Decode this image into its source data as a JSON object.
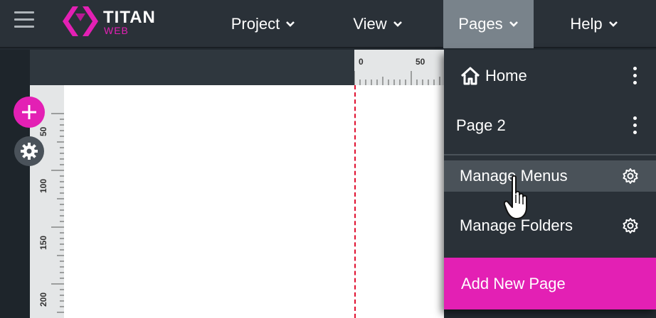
{
  "app": {
    "logo_title": "TITAN",
    "logo_sub": "WEB",
    "brand_color": "#e320b4"
  },
  "nav": {
    "project": "Project",
    "view": "View",
    "pages": "Pages",
    "help": "Help"
  },
  "ruler": {
    "top_ticks": [
      "0",
      "50"
    ],
    "left_ticks": [
      "50",
      "100",
      "150",
      "200"
    ]
  },
  "pages_menu": {
    "home": "Home",
    "page2": "Page 2",
    "manage_menus": "Manage Menus",
    "manage_folders": "Manage Folders",
    "add_new_page": "Add New Page"
  },
  "icons": {
    "hamburger": "hamburger-icon",
    "home": "home-icon",
    "kebab": "kebab-icon",
    "gear": "gear-icon",
    "plus": "plus-icon",
    "cursor": "hand-cursor-icon"
  }
}
